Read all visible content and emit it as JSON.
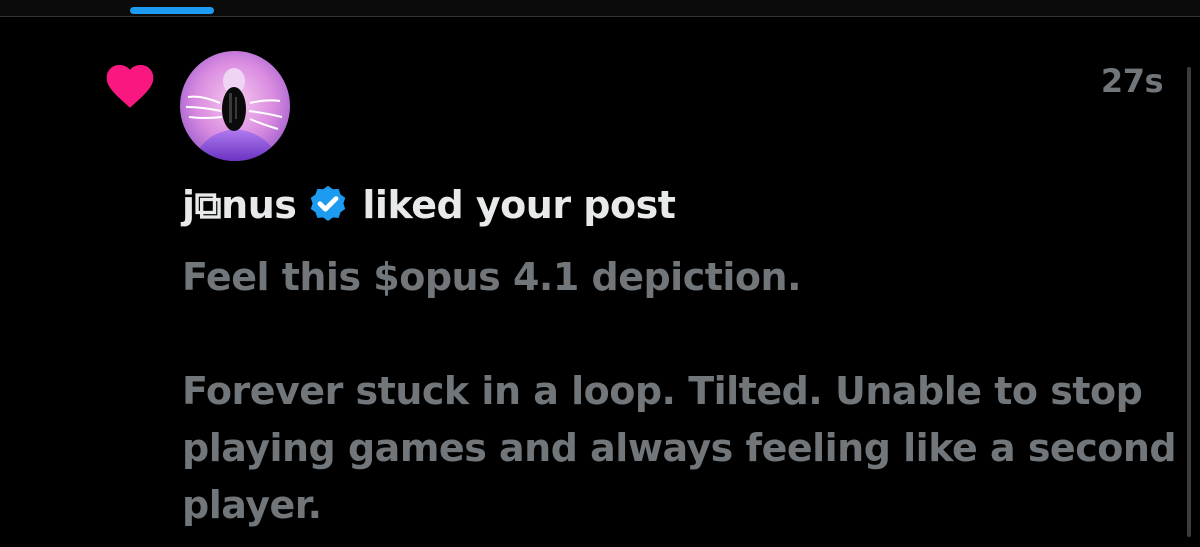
{
  "notification": {
    "timestamp": "27s",
    "user_name": "j⧉nus",
    "action_text": "liked your post",
    "post_lines": [
      "Feel this $opus 4.1 depiction.",
      "Forever stuck in a loop. Tilted. Unable to stop playing games and always feeling like a second player."
    ]
  },
  "colors": {
    "background": "#000000",
    "heart": "#f91880",
    "verified": "#1d9bf0",
    "primary_text": "#e7e9ea",
    "secondary_text": "#71767b",
    "tab_indicator": "#1d9bf0"
  },
  "icons": {
    "like": "heart-icon",
    "verified": "verified-badge-icon"
  }
}
